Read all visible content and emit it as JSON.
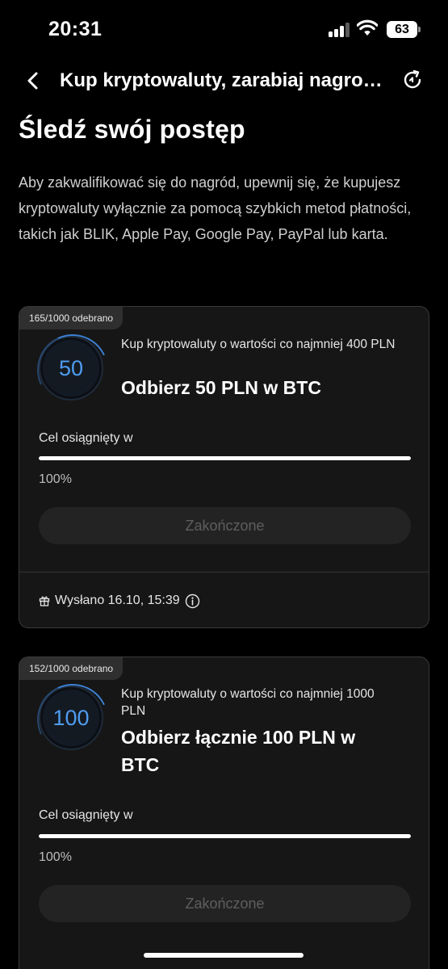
{
  "status_bar": {
    "time": "20:31",
    "battery": "63",
    "signal_bars_active": 3,
    "signal_bars_total": 4
  },
  "nav": {
    "title": "Kup kryptowaluty, zarabiaj nagrody",
    "back_icon": "chevron-left-icon",
    "refresh_icon": "refresh-icon"
  },
  "page": {
    "title": "Śledź swój postęp",
    "intro": "Aby zakwalifikować się do nagród, upewnij się, że kupujesz kryptowaluty wyłącznie za pomocą szybkich metod płatności, takich jak BLIK, Apple Pay, Google Pay, PayPal lub karta."
  },
  "rewards": [
    {
      "claimed": "165/1000 odebrano",
      "amount": "50",
      "requirement": "Kup kryptowaluty o wartości co najmniej 400 PLN",
      "reward": "Odbierz 50 PLN w BTC",
      "goal_label": "Cel osiągnięty w",
      "progress_percent": 100,
      "progress_text": "100%",
      "button": "Zakończone",
      "sent": "Wysłano 16.10, 15:39"
    },
    {
      "claimed": "152/1000 odebrano",
      "amount": "100",
      "requirement": "Kup kryptowaluty o wartości co najmniej 1000 PLN",
      "reward": "Odbierz łącznie 100 PLN w BTC",
      "goal_label": "Cel osiągnięty w",
      "progress_percent": 100,
      "progress_text": "100%",
      "button": "Zakończone"
    }
  ],
  "colors": {
    "background": "#000000",
    "card": "#161616",
    "accent_ring": "#4f9cf0",
    "progress": "#ffffff"
  }
}
